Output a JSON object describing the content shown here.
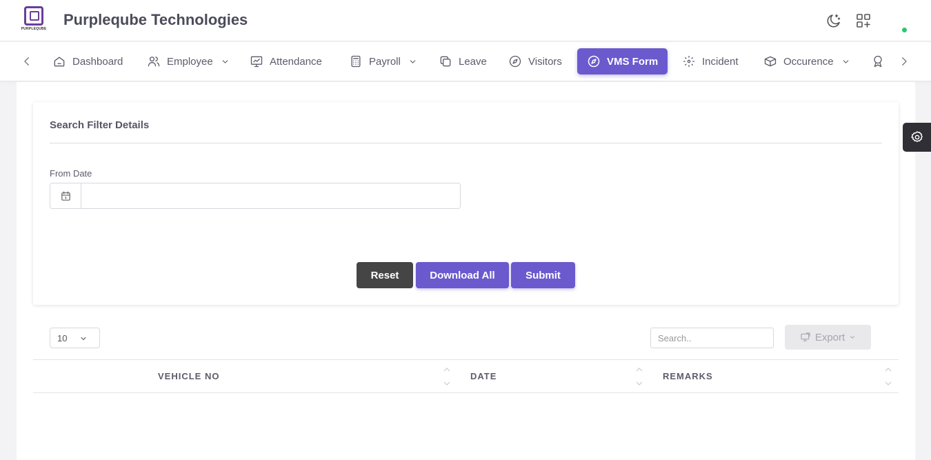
{
  "header": {
    "logo_text": "PURPLEQUBE",
    "brand": "Purpleqube Technologies",
    "icons": [
      "moon-star-icon",
      "grid-plus-icon"
    ],
    "status_color": "#28c76f"
  },
  "nav": {
    "items": [
      {
        "label": "Dashboard",
        "icon": "home-icon"
      },
      {
        "label": "Employee",
        "icon": "users-icon",
        "dropdown": true
      },
      {
        "label": "Attendance",
        "icon": "chart-icon"
      },
      {
        "label": "Payroll",
        "icon": "calculator-icon",
        "dropdown": true
      },
      {
        "label": "Leave",
        "icon": "copy-icon"
      },
      {
        "label": "Visitors",
        "icon": "compass-icon"
      },
      {
        "label": "VMS Form",
        "icon": "compass-icon",
        "active": true
      },
      {
        "label": "Incident",
        "icon": "focus-icon"
      },
      {
        "label": "Occurence",
        "icon": "boxes-icon",
        "dropdown": true
      }
    ],
    "accent": "#6a5acd"
  },
  "filter": {
    "title": "Search Filter Details",
    "from_date_label": "From Date",
    "from_date_value": "",
    "reset_label": "Reset",
    "download_label": "Download All",
    "submit_label": "Submit"
  },
  "table": {
    "page_length": "10",
    "search_placeholder": "Search..",
    "export_label": "Export",
    "columns": [
      "VEHICLE NO",
      "DATE",
      "REMARKS"
    ],
    "rows": []
  }
}
